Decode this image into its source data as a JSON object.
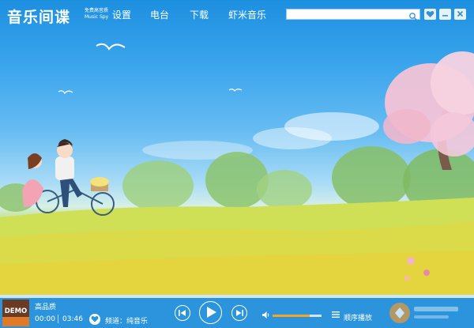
{
  "app": {
    "logo_text": "音乐间谍",
    "logo_tagline": "免费高音质",
    "logo_english": "Music Spy"
  },
  "nav": {
    "items": [
      {
        "label": "设置"
      },
      {
        "label": "电台"
      },
      {
        "label": "下载"
      },
      {
        "label": "虾米音乐"
      }
    ]
  },
  "search": {
    "value": "",
    "placeholder": ""
  },
  "player": {
    "cover_label": "DEMO",
    "track_title": "高品质",
    "elapsed": "00:00",
    "duration": "03:46",
    "channel_label": "频道：纯音乐",
    "play_mode": "顺序播放",
    "volume_fraction": 0.75,
    "progress_fraction": 0.0
  },
  "colors": {
    "player_bar": "#2b94dc",
    "accent": "#f5a623",
    "cover_bg": "#6b3a23"
  },
  "icons": {
    "search": "search-icon",
    "heart": "heart-icon",
    "minimize": "minimize-icon",
    "close": "close-icon",
    "prev": "previous-icon",
    "play": "play-icon",
    "next": "next-icon",
    "volume": "volume-icon",
    "mode": "list-icon"
  }
}
